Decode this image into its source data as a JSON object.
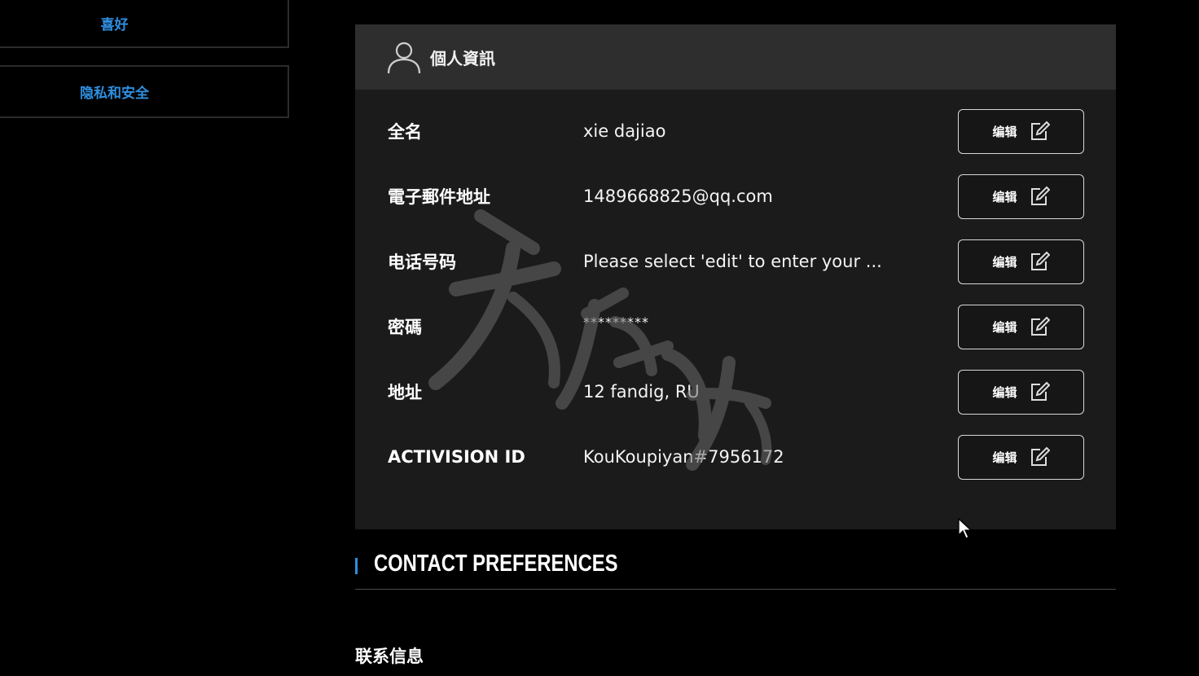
{
  "sidebar": {
    "items": [
      {
        "label": "喜好"
      },
      {
        "label": "隐私和安全"
      }
    ]
  },
  "personal_info": {
    "title": "個人資訊",
    "icon": "user-icon",
    "rows": [
      {
        "label": "全名",
        "value": "xie dajiao",
        "edit_label": "编辑"
      },
      {
        "label": "電子郵件地址",
        "value": "1489668825@qq.com",
        "edit_label": "编辑"
      },
      {
        "label": "电话号码",
        "value": "Please select 'edit' to enter your ...",
        "edit_label": "编辑"
      },
      {
        "label": "密碼",
        "value": "*********",
        "edit_label": "编辑"
      },
      {
        "label": "地址",
        "value": "12 fandig, RU",
        "edit_label": "编辑"
      },
      {
        "label": "ACTIVISION ID",
        "value": "KouKoupiyan#7956172",
        "edit_label": "编辑"
      }
    ]
  },
  "contact_preferences": {
    "title": "CONTACT PREFERENCES",
    "subheading": "联系信息"
  },
  "colors": {
    "accent": "#2f8fe0",
    "card_bg": "#1b1b1b",
    "header_bg": "#2e2e2e"
  }
}
